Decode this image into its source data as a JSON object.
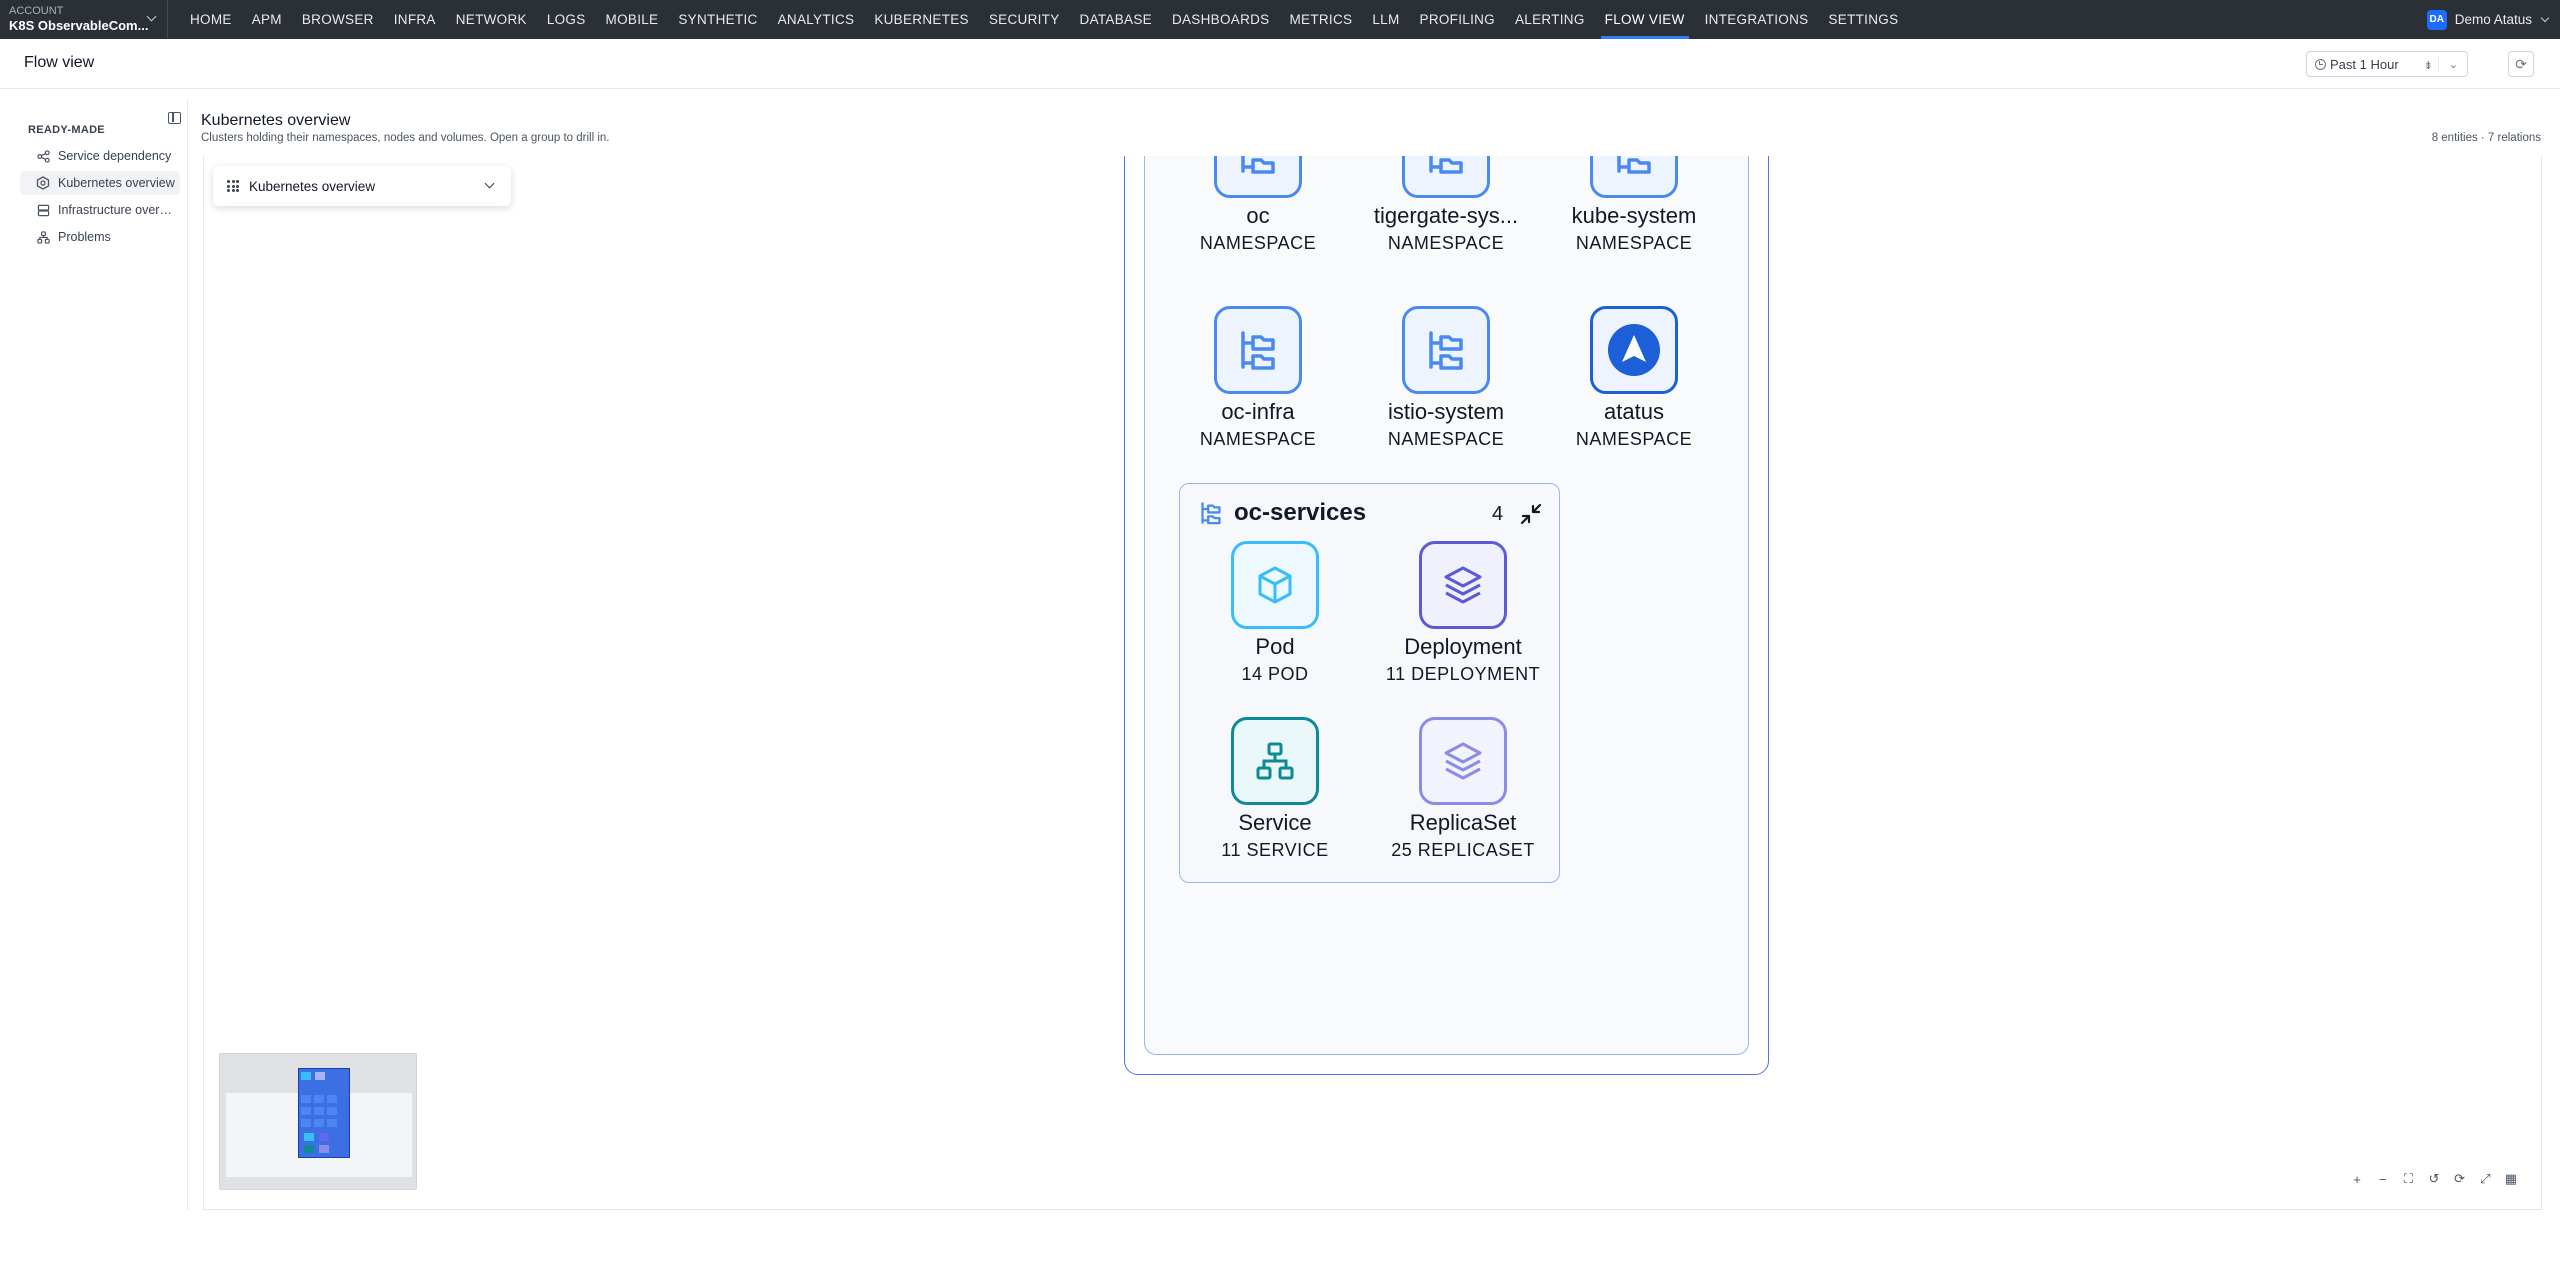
{
  "account": {
    "label": "ACCOUNT",
    "name": "K8S ObservableCom..."
  },
  "nav": {
    "items": [
      "HOME",
      "APM",
      "BROWSER",
      "INFRA",
      "NETWORK",
      "LOGS",
      "MOBILE",
      "SYNTHETIC",
      "ANALYTICS",
      "KUBERNETES",
      "SECURITY",
      "DATABASE",
      "DASHBOARDS",
      "METRICS",
      "LLM",
      "PROFILING",
      "ALERTING",
      "FLOW VIEW",
      "INTEGRATIONS",
      "SETTINGS"
    ],
    "active": "FLOW VIEW"
  },
  "user": {
    "initials": "DA",
    "name": "Demo Atatus"
  },
  "page": {
    "title": "Flow view"
  },
  "timepicker": {
    "value": "Past 1 Hour"
  },
  "sidebar": {
    "section": "READY-MADE",
    "items": [
      {
        "label": "Service dependency",
        "icon": "share-nodes-icon"
      },
      {
        "label": "Kubernetes overview",
        "icon": "kubernetes-helm-icon",
        "active": true
      },
      {
        "label": "Infrastructure overvi...",
        "icon": "server-stack-icon"
      },
      {
        "label": "Problems",
        "icon": "graph-nodes-icon"
      }
    ]
  },
  "content": {
    "title": "Kubernetes overview",
    "subtitle": "Clusters holding their namespaces, nodes and volumes. Open a group to drill in.",
    "meta": "8 entities · 7 relations"
  },
  "view_selector": {
    "value": "Kubernetes overview"
  },
  "namespaces": [
    {
      "name": "oc",
      "type": "NAMESPACE",
      "icon": "namespace-folder-tree-icon"
    },
    {
      "name": "tigergate-sys...",
      "type": "NAMESPACE",
      "icon": "namespace-folder-tree-icon"
    },
    {
      "name": "kube-system",
      "type": "NAMESPACE",
      "icon": "namespace-folder-tree-icon"
    },
    {
      "name": "oc-infra",
      "type": "NAMESPACE",
      "icon": "namespace-folder-tree-icon"
    },
    {
      "name": "istio-system",
      "type": "NAMESPACE",
      "icon": "namespace-folder-tree-icon"
    },
    {
      "name": "atatus",
      "type": "NAMESPACE",
      "icon": "atatus-logo-icon"
    }
  ],
  "group": {
    "name": "oc-services",
    "count": "4",
    "children": [
      {
        "name": "Pod",
        "type": "14 POD",
        "icon": "cube-icon",
        "color": "#38bdf8"
      },
      {
        "name": "Deployment",
        "type": "11 DEPLOYMENT",
        "icon": "layers-icon",
        "color": "#5b5bd6"
      },
      {
        "name": "Service",
        "type": "11 SERVICE",
        "icon": "sitemap-icon",
        "color": "#0e8a96"
      },
      {
        "name": "ReplicaSet",
        "type": "25 REPLICASET",
        "icon": "layers-icon",
        "color": "#8b8be8"
      }
    ]
  },
  "colors": {
    "nav_bg": "#2b2f36",
    "accent": "#2f7dff",
    "namespace_blue": "#4a8af0",
    "cluster_border": "#4a76ee"
  }
}
